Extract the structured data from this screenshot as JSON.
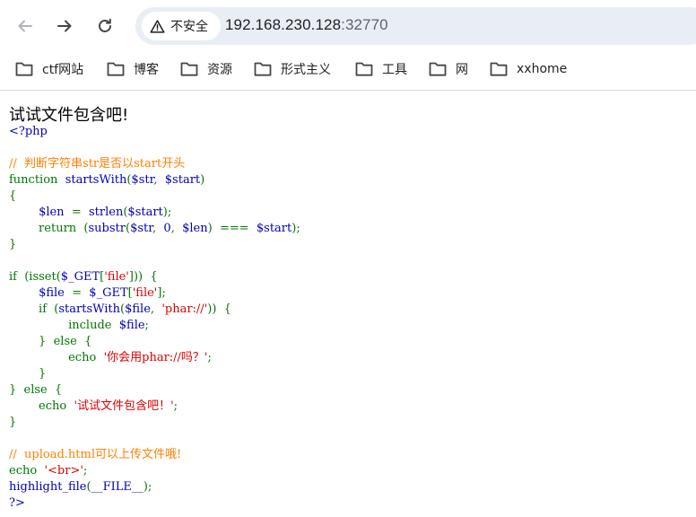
{
  "browser": {
    "security_label": "不安全",
    "url_host": "192.168.230.128",
    "url_port": ":32770",
    "bookmarks": [
      {
        "label": "ctf网站"
      },
      {
        "label": "博客"
      },
      {
        "label": "资源"
      },
      {
        "label": "形式主义"
      },
      {
        "label": "工具"
      },
      {
        "label": "网"
      },
      {
        "label": "xxhome"
      }
    ]
  },
  "page": {
    "heading": "试试文件包含吧!"
  },
  "source_code": [
    [
      {
        "t": "<?php",
        "c": "d"
      }
    ],
    [],
    [
      {
        "t": "//  判断字符串str是否以start开头",
        "c": "c"
      }
    ],
    [
      {
        "t": "function  ",
        "c": "k"
      },
      {
        "t": "startsWith",
        "c": "d"
      },
      {
        "t": "(",
        "c": "k"
      },
      {
        "t": "$str",
        "c": "d"
      },
      {
        "t": ",  ",
        "c": "k"
      },
      {
        "t": "$start",
        "c": "d"
      },
      {
        "t": ")",
        "c": "k"
      }
    ],
    [
      {
        "t": "{",
        "c": "k"
      }
    ],
    [
      {
        "t": "        ",
        "c": "k"
      },
      {
        "t": "$len  ",
        "c": "d"
      },
      {
        "t": "=  ",
        "c": "k"
      },
      {
        "t": "strlen",
        "c": "d"
      },
      {
        "t": "(",
        "c": "k"
      },
      {
        "t": "$start",
        "c": "d"
      },
      {
        "t": ");",
        "c": "k"
      }
    ],
    [
      {
        "t": "        return  (",
        "c": "k"
      },
      {
        "t": "substr",
        "c": "d"
      },
      {
        "t": "(",
        "c": "k"
      },
      {
        "t": "$str",
        "c": "d"
      },
      {
        "t": ",  ",
        "c": "k"
      },
      {
        "t": "0",
        "c": "d"
      },
      {
        "t": ",  ",
        "c": "k"
      },
      {
        "t": "$len",
        "c": "d"
      },
      {
        "t": ")  ===  ",
        "c": "k"
      },
      {
        "t": "$start",
        "c": "d"
      },
      {
        "t": ");",
        "c": "k"
      }
    ],
    [
      {
        "t": "}",
        "c": "k"
      }
    ],
    [],
    [
      {
        "t": "if  (isset(",
        "c": "k"
      },
      {
        "t": "$_GET",
        "c": "d"
      },
      {
        "t": "[",
        "c": "k"
      },
      {
        "t": "'file'",
        "c": "s"
      },
      {
        "t": "]))  {",
        "c": "k"
      }
    ],
    [
      {
        "t": "        ",
        "c": "k"
      },
      {
        "t": "$file  ",
        "c": "d"
      },
      {
        "t": "=  ",
        "c": "k"
      },
      {
        "t": "$_GET",
        "c": "d"
      },
      {
        "t": "[",
        "c": "k"
      },
      {
        "t": "'file'",
        "c": "s"
      },
      {
        "t": "];",
        "c": "k"
      }
    ],
    [
      {
        "t": "        if  (",
        "c": "k"
      },
      {
        "t": "startsWith",
        "c": "d"
      },
      {
        "t": "(",
        "c": "k"
      },
      {
        "t": "$file",
        "c": "d"
      },
      {
        "t": ",  ",
        "c": "k"
      },
      {
        "t": "'phar://'",
        "c": "s"
      },
      {
        "t": "))  {",
        "c": "k"
      }
    ],
    [
      {
        "t": "                include  ",
        "c": "k"
      },
      {
        "t": "$file",
        "c": "d"
      },
      {
        "t": ";",
        "c": "k"
      }
    ],
    [
      {
        "t": "        }  else  {",
        "c": "k"
      }
    ],
    [
      {
        "t": "                echo  ",
        "c": "k"
      },
      {
        "t": "'你会用phar://吗？'",
        "c": "s"
      },
      {
        "t": ";",
        "c": "k"
      }
    ],
    [
      {
        "t": "        }",
        "c": "k"
      }
    ],
    [
      {
        "t": "}  else  {",
        "c": "k"
      }
    ],
    [
      {
        "t": "        echo  ",
        "c": "k"
      },
      {
        "t": "'试试文件包含吧！'",
        "c": "s"
      },
      {
        "t": ";",
        "c": "k"
      }
    ],
    [
      {
        "t": "}",
        "c": "k"
      }
    ],
    [],
    [
      {
        "t": "//  upload.html可以上传文件哦!",
        "c": "c"
      }
    ],
    [
      {
        "t": "echo  ",
        "c": "k"
      },
      {
        "t": "'<br>'",
        "c": "s"
      },
      {
        "t": ";",
        "c": "k"
      }
    ],
    [
      {
        "t": "highlight_file",
        "c": "d"
      },
      {
        "t": "(",
        "c": "k"
      },
      {
        "t": "__FILE__",
        "c": "d"
      },
      {
        "t": ");",
        "c": "k"
      }
    ],
    [
      {
        "t": "?>",
        "c": "d"
      }
    ]
  ]
}
